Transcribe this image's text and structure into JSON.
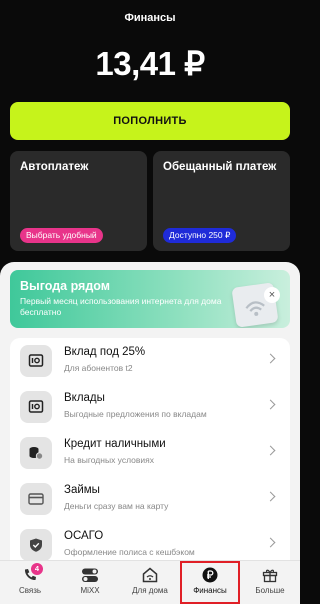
{
  "header": {
    "title": "Финансы"
  },
  "balance": {
    "amount": "13,41 ₽"
  },
  "topup": {
    "label": "ПОПОЛНИТЬ"
  },
  "cards": [
    {
      "title": "Автоплатеж",
      "pill": "Выбрать удобный",
      "pill_color": "#e8348a"
    },
    {
      "title": "Обещанный платеж",
      "pill": "Доступно 250 ₽",
      "pill_color": "#1f2bd8"
    }
  ],
  "promo": {
    "title": "Выгода рядом",
    "subtitle": "Первый месяц использования интернета для дома бесплатно",
    "close": "×"
  },
  "services": [
    {
      "title": "Вклад под 25%",
      "subtitle": "Для абонентов t2",
      "icon": "safe-icon"
    },
    {
      "title": "Вклады",
      "subtitle": "Выгодные предложения по вкладам",
      "icon": "safe-icon"
    },
    {
      "title": "Кредит наличными",
      "subtitle": "На выгодных условиях",
      "icon": "coins-icon"
    },
    {
      "title": "Займы",
      "subtitle": "Деньги сразу вам на карту",
      "icon": "card-icon"
    },
    {
      "title": "ОСАГО",
      "subtitle": "Оформление полиса с кешбэком",
      "icon": "shield-icon"
    }
  ],
  "nav": {
    "items": [
      {
        "label": "Связь",
        "icon": "phone-icon",
        "badge": "4"
      },
      {
        "label": "MiXX",
        "icon": "toggle-icon"
      },
      {
        "label": "Для дома",
        "icon": "home-wifi-icon"
      },
      {
        "label": "Финансы",
        "icon": "ruble-icon",
        "active": true
      },
      {
        "label": "Больше",
        "icon": "gift-icon"
      }
    ]
  },
  "colors": {
    "accent": "#c6f31b",
    "active_outline": "#e01f26",
    "pink": "#e8348a",
    "blue": "#1f2bd8"
  }
}
